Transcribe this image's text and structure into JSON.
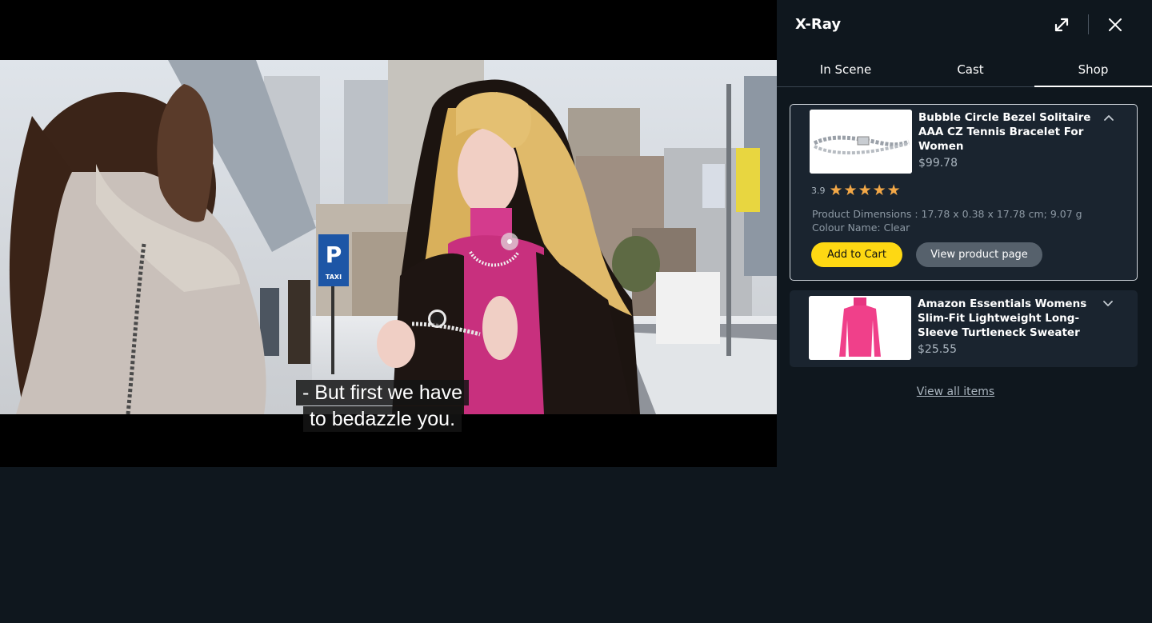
{
  "video": {
    "subtitle_line1": "- But first we have",
    "subtitle_line2": "to bedazzle you."
  },
  "panel": {
    "title": "X-Ray",
    "tabs": [
      {
        "label": "In Scene",
        "active": false
      },
      {
        "label": "Cast",
        "active": false
      },
      {
        "label": "Shop",
        "active": true
      }
    ],
    "products": [
      {
        "title": "Bubble Circle Bezel Solitaire AAA CZ Tennis Bracelet For Women",
        "price": "$99.78",
        "rating": "3.9",
        "stars": "★★★★★",
        "dimensions": "Product Dimensions  :  17.78 x 0.38 x 17.78 cm; 9.07 g",
        "colour": "Colour Name: Clear",
        "add_to_cart": "Add to Cart",
        "view_page": "View product page",
        "expanded": true
      },
      {
        "title": "Amazon Essentials Womens Slim-Fit Lightweight Long-Sleeve Turtleneck Sweater",
        "price": "$25.55",
        "expanded": false
      }
    ],
    "view_all": "View all items"
  },
  "colors": {
    "background": "#0f171e",
    "card": "#1a242f",
    "add_to_cart": "#fed813",
    "view_page_button": "#56616c",
    "star": "#f3a847"
  },
  "icons": [
    "expand-icon",
    "close-icon",
    "chevron-up-icon",
    "chevron-down-icon"
  ]
}
